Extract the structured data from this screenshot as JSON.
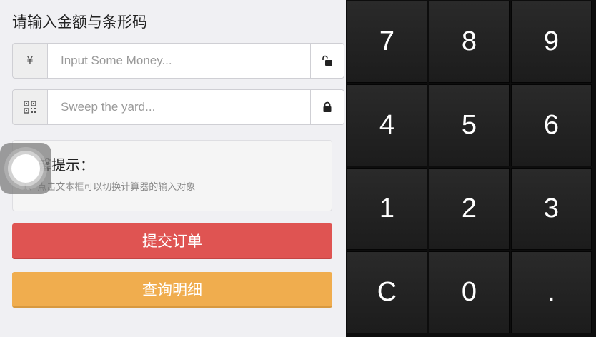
{
  "form": {
    "title": "请输入金额与条形码",
    "amount": {
      "prefix_symbol": "¥",
      "placeholder": "Input Some Money...",
      "value": "",
      "lock_icon": "unlocked-padlock-icon"
    },
    "barcode": {
      "prefix_icon": "qr-code-icon",
      "placeholder": "Sweep the yard...",
      "value": "",
      "lock_icon": "locked-padlock-icon"
    }
  },
  "tips": {
    "title": "温馨提示：",
    "lines": [
      "1、点击文本框可以切换计算器的输入对象"
    ]
  },
  "buttons": {
    "submit_label": "提交订单",
    "query_label": "查询明细"
  },
  "keypad": {
    "keys": [
      "7",
      "8",
      "9",
      "4",
      "5",
      "6",
      "1",
      "2",
      "3",
      "C",
      "0",
      "."
    ]
  },
  "colors": {
    "submit": "#df5452",
    "query": "#f0ad4e",
    "keypad_bg": "#1c1c1c",
    "page_bg": "#f0f0f3"
  }
}
